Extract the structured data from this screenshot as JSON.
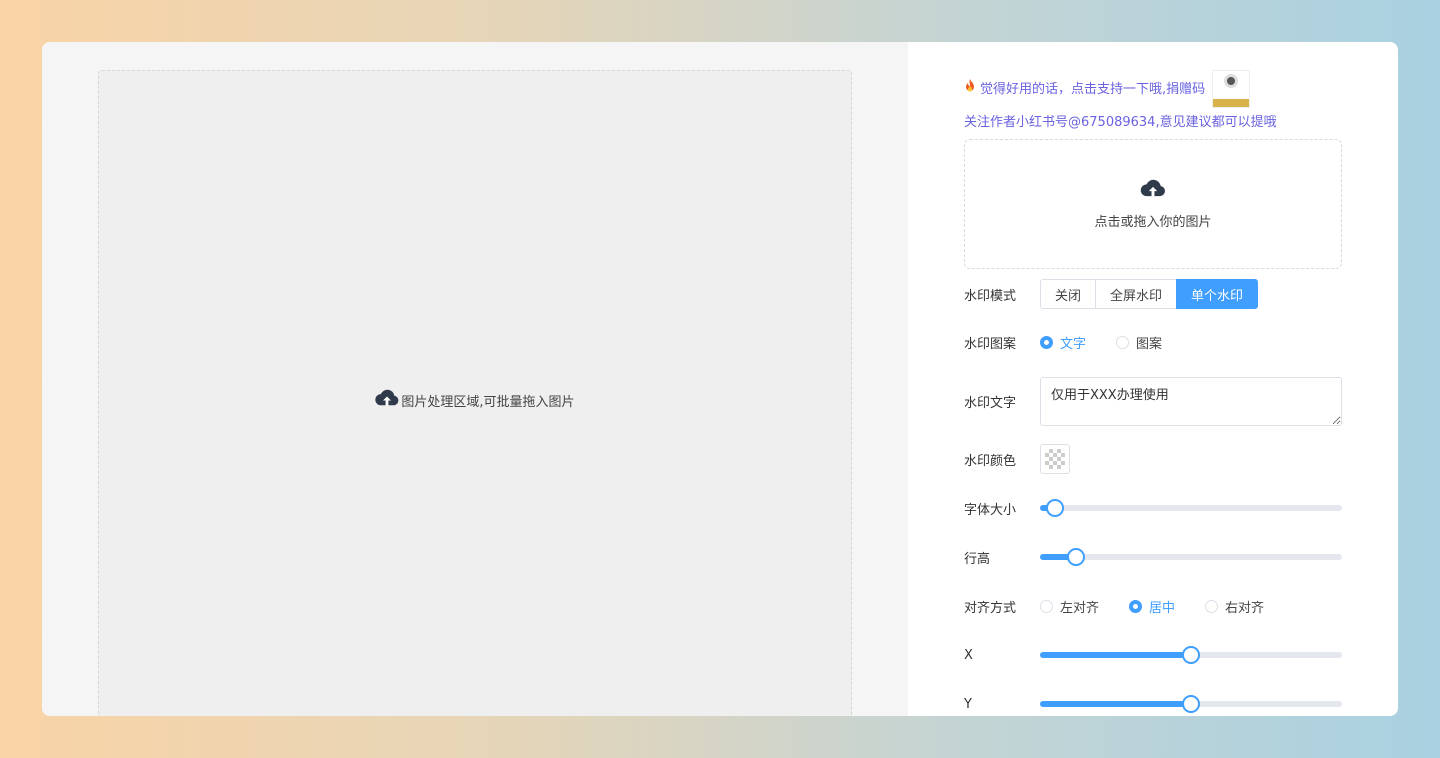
{
  "workspace": {
    "drop_hint": "图片处理区域,可批量拖入图片",
    "icon": "cloud-upload-icon"
  },
  "sidebar": {
    "notice_line1": "觉得好用的话，点击支持一下哦,捐赠码",
    "notice_icon": "fire-icon",
    "notice_line2": "关注作者小红书号@675089634,意见建议都可以提哦",
    "upload_text": "点击或拖入你的图片",
    "accent_color": "#409eff",
    "notice_color": "#6a62e0"
  },
  "form": {
    "mode": {
      "label": "水印模式",
      "options": [
        "关闭",
        "全屏水印",
        "单个水印"
      ],
      "selected": "单个水印"
    },
    "pattern": {
      "label": "水印图案",
      "options": [
        "文字",
        "图案"
      ],
      "selected": "文字"
    },
    "text": {
      "label": "水印文字",
      "value": "仅用于XXX办理使用"
    },
    "color": {
      "label": "水印颜色",
      "value": "transparent"
    },
    "font_size": {
      "label": "字体大小",
      "value": 0.05
    },
    "line_height": {
      "label": "行高",
      "value": 0.12
    },
    "align": {
      "label": "对齐方式",
      "options": [
        "左对齐",
        "居中",
        "右对齐"
      ],
      "selected": "居中"
    },
    "x": {
      "label": "X",
      "value": 0.5
    },
    "y": {
      "label": "Y",
      "value": 0.5
    }
  }
}
